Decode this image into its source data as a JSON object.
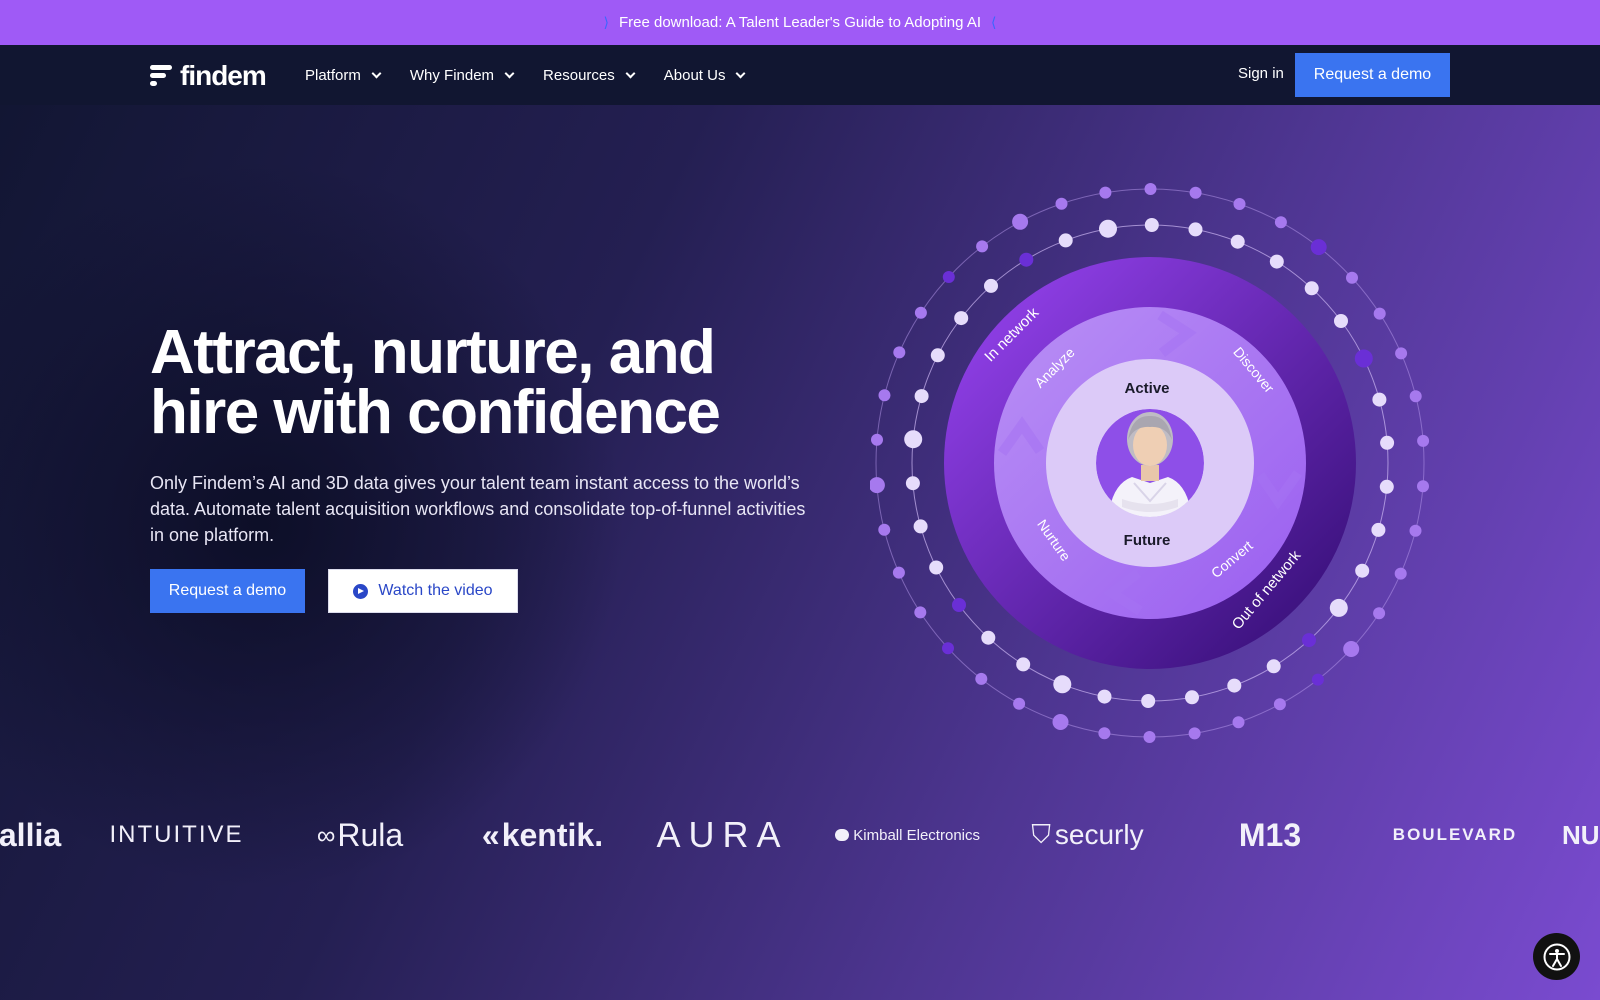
{
  "banner": {
    "text": "Free download: A Talent Leader's Guide to Adopting AI"
  },
  "nav": {
    "logo": "findem",
    "items": [
      {
        "label": "Platform"
      },
      {
        "label": "Why Findem"
      },
      {
        "label": "Resources"
      },
      {
        "label": "About Us"
      }
    ],
    "sign_in": "Sign in",
    "cta": "Request a demo"
  },
  "hero": {
    "headline": "Attract, nurture, and hire with confidence",
    "subcopy": "Only Findem’s AI and 3D data gives your talent team instant access to the world’s data. Automate talent acquisition workflows and consolidate top-of-funnel activities in one platform.",
    "primary_cta": "Request a demo",
    "secondary_cta": "Watch the video"
  },
  "diagram": {
    "outer_labels": [
      "In network",
      "Out of network"
    ],
    "ring_labels": [
      "Analyze",
      "Discover",
      "Nurture",
      "Convert"
    ],
    "inner_labels": [
      "Active",
      "Future"
    ]
  },
  "logos": [
    "allia",
    "INTUITIVE",
    "Rula",
    "kentik.",
    "AURA",
    "Kimball Electronics",
    "securly",
    "M13",
    "BOULEVARD",
    "NU"
  ],
  "colors": {
    "banner": "#9f5af6",
    "cta": "#3a74f0",
    "nav": "#111631"
  }
}
